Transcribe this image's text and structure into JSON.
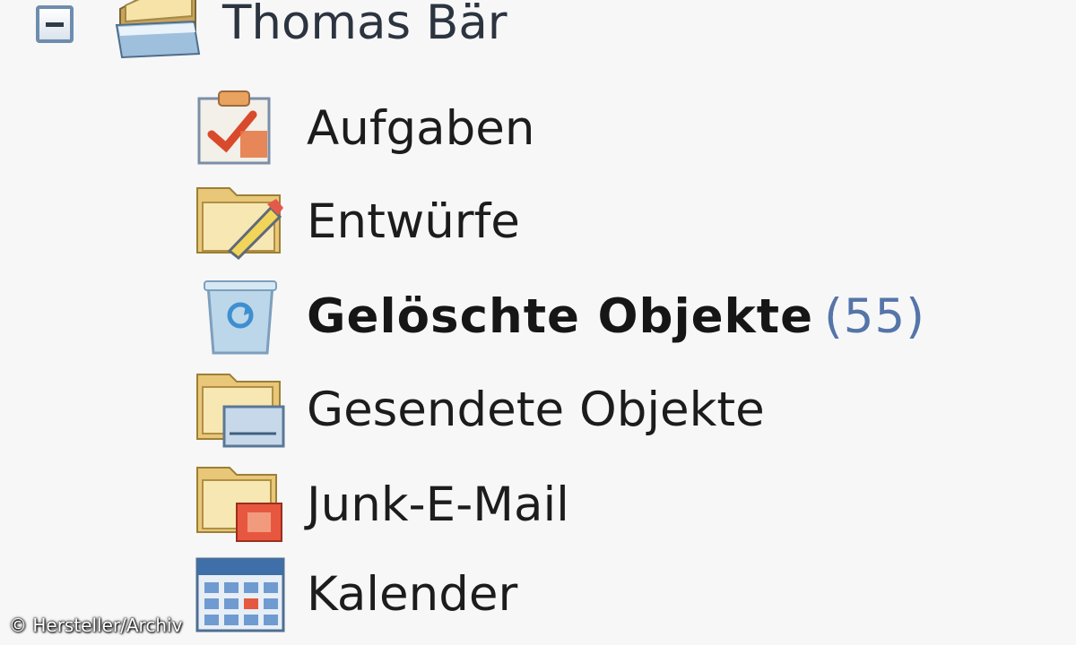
{
  "root": {
    "label": "Thomas Bär",
    "expanded": true,
    "icon": "mailbox-folder-icon"
  },
  "folders": [
    {
      "label": "Aufgaben",
      "icon": "tasks-icon",
      "bold": false,
      "count": ""
    },
    {
      "label": "Entwürfe",
      "icon": "drafts-icon",
      "bold": false,
      "count": ""
    },
    {
      "label": "Gelöschte Objekte",
      "icon": "deleted-items-icon",
      "bold": true,
      "count": "(55)"
    },
    {
      "label": "Gesendete Objekte",
      "icon": "sent-items-icon",
      "bold": false,
      "count": ""
    },
    {
      "label": "Junk-E-Mail",
      "icon": "junk-mail-icon",
      "bold": false,
      "count": ""
    },
    {
      "label": "Kalender",
      "icon": "calendar-icon",
      "bold": false,
      "count": ""
    }
  ],
  "credit": "© Hersteller/Archiv",
  "colors": {
    "background": "#f7f7f8",
    "count": "#5575a8",
    "text": "#1c1c1c"
  }
}
